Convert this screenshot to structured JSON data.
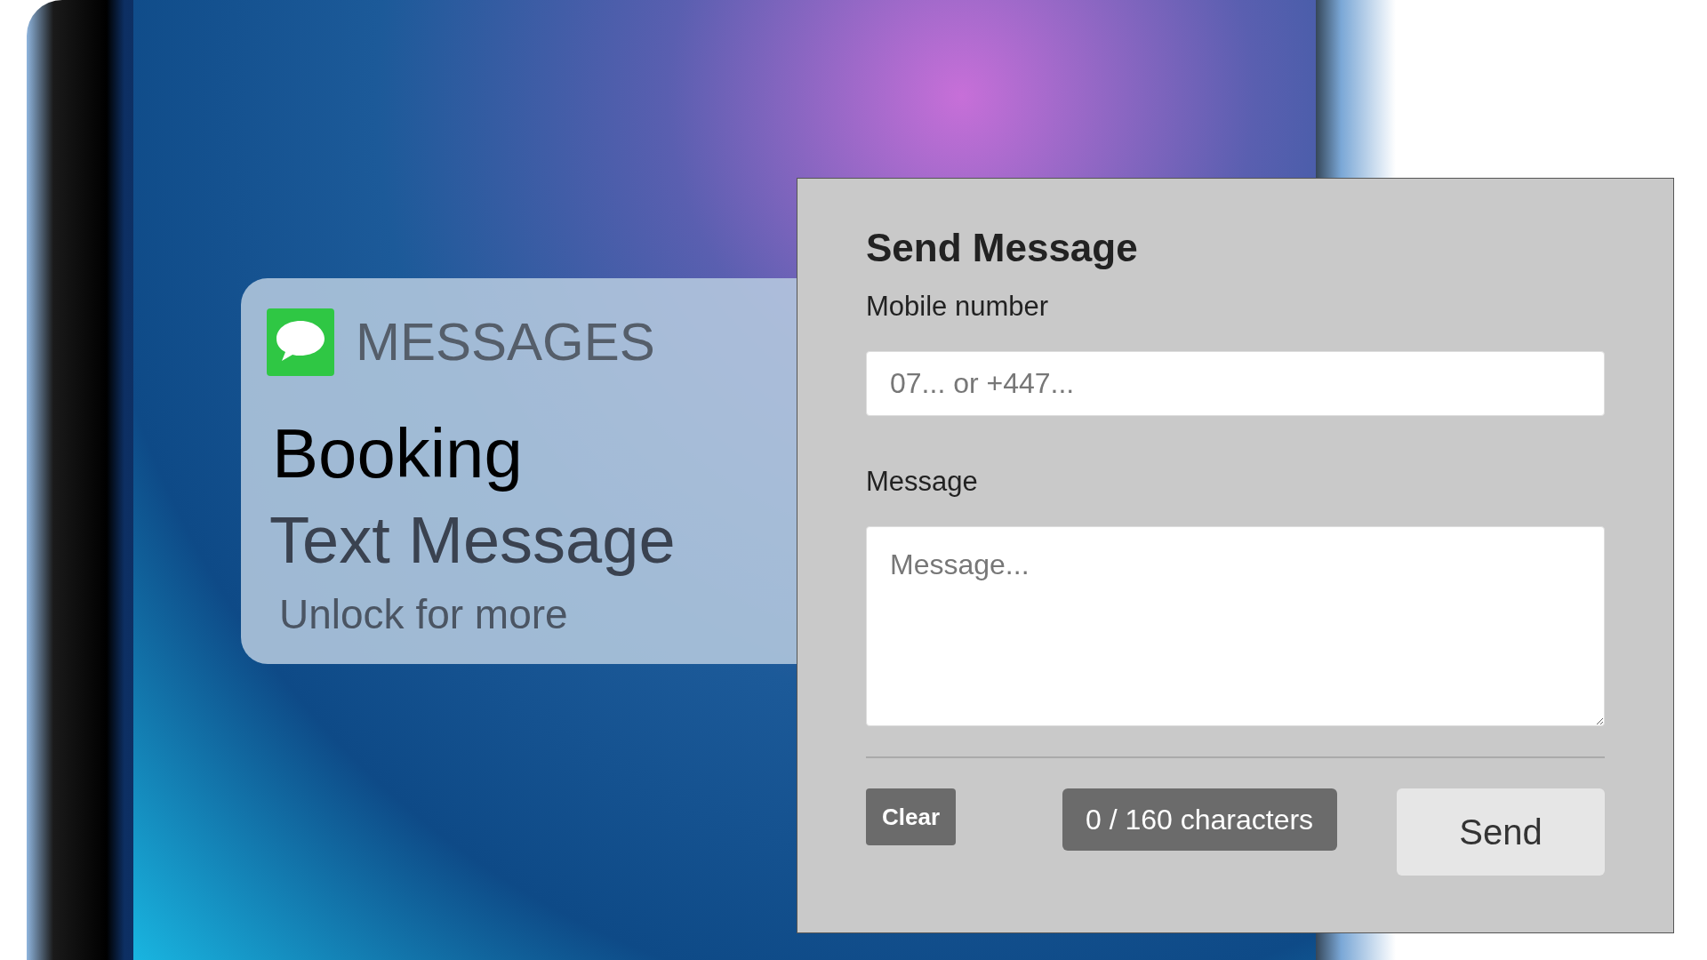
{
  "notification": {
    "app": "MESSAGES",
    "title": "Booking",
    "subtitle": "Text Message",
    "hint": "Unlock for more"
  },
  "form": {
    "title": "Send Message",
    "fields": [
      {
        "kind": "input",
        "label": "Mobile number",
        "placeholder": "07... or +447..."
      },
      {
        "kind": "textarea",
        "label": "Message",
        "placeholder": "Message..."
      }
    ],
    "clear_button": "Clear",
    "counter": "0 / 160 characters",
    "send_button": "Send"
  }
}
